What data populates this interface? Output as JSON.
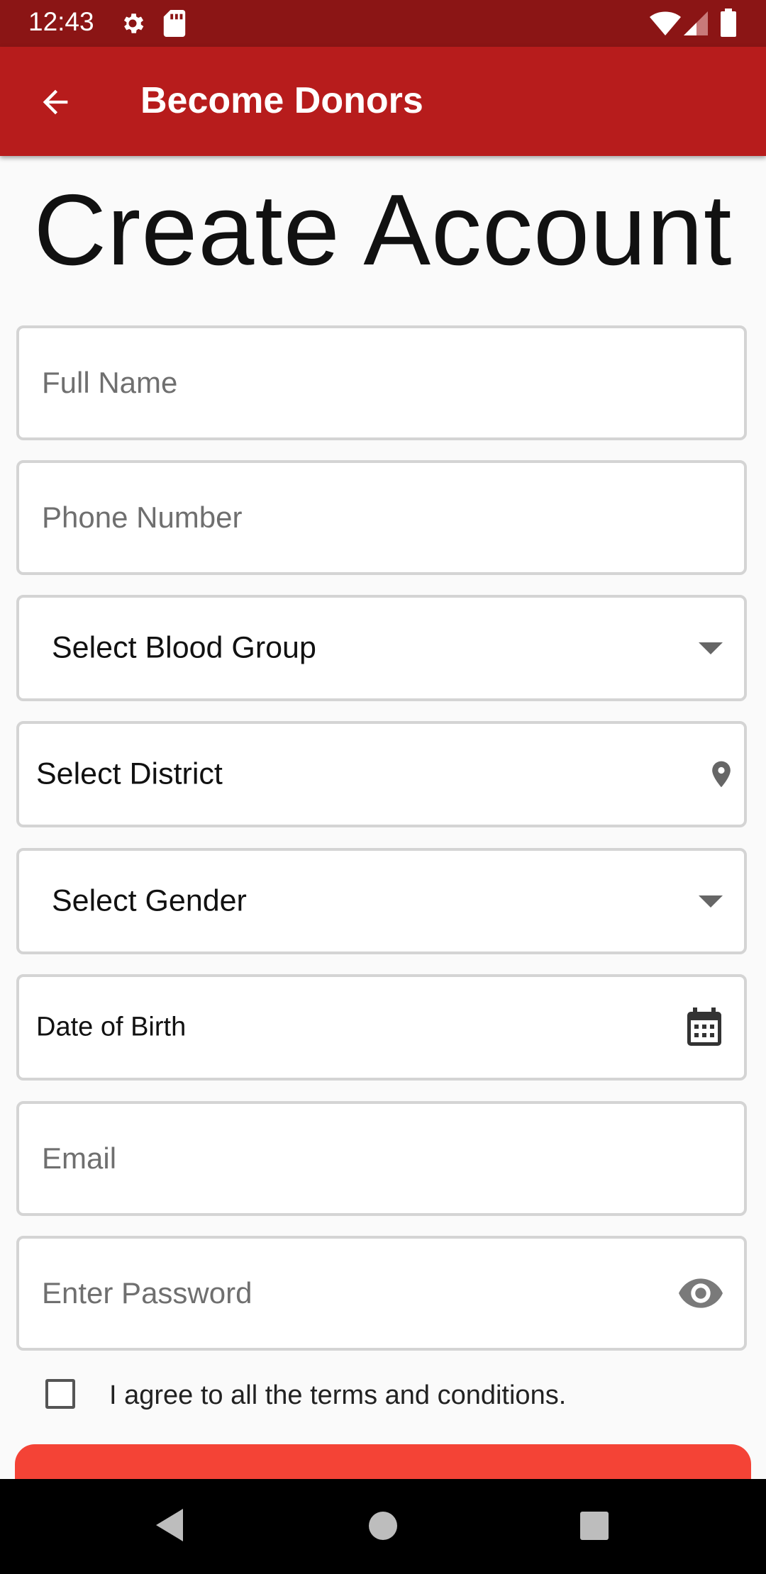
{
  "status_bar": {
    "time": "12:43",
    "icons": [
      "gear-icon",
      "sd-card-icon",
      "wifi-icon",
      "cell-signal-icon",
      "battery-icon"
    ]
  },
  "app_bar": {
    "title": "Become Donors",
    "back_icon": "arrow-back-icon",
    "color": "#b71c1c",
    "status_color": "#8b1515"
  },
  "form": {
    "heading": "Create Account",
    "full_name_placeholder": "Full Name",
    "phone_placeholder": "Phone Number",
    "blood_group_label": "Select Blood Group",
    "district_label": "Select District",
    "gender_label": "Select Gender",
    "dob_label": "Date of Birth",
    "email_placeholder": "Email",
    "password_placeholder": "Enter Password",
    "terms_label": "I agree to all the terms and conditions.",
    "terms_checked": false,
    "button_color": "#f44336"
  },
  "nav_bar": {
    "icons": [
      "nav-back-icon",
      "nav-home-icon",
      "nav-recents-icon"
    ]
  }
}
